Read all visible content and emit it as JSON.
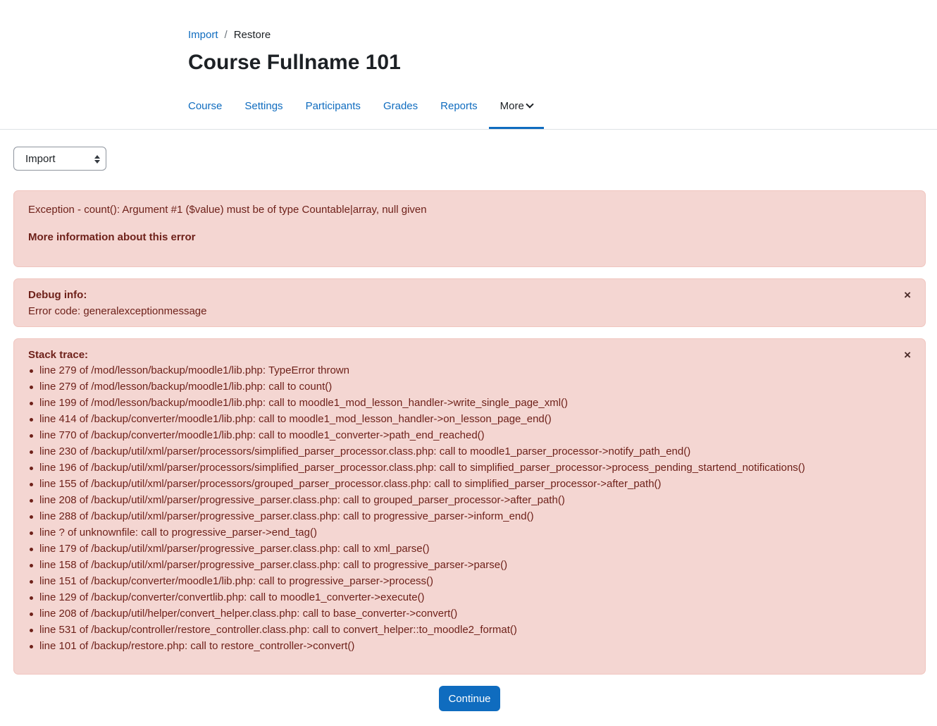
{
  "breadcrumb": {
    "items": [
      {
        "label": "Import",
        "link": true
      },
      {
        "label": "Restore",
        "link": false
      }
    ],
    "separator": "/"
  },
  "page": {
    "title": "Course Fullname 101"
  },
  "secondary_nav": {
    "tabs": [
      {
        "label": "Course",
        "active": false
      },
      {
        "label": "Settings",
        "active": false
      },
      {
        "label": "Participants",
        "active": false
      },
      {
        "label": "Grades",
        "active": false
      },
      {
        "label": "Reports",
        "active": false
      },
      {
        "label": "More",
        "active": true
      }
    ]
  },
  "select": {
    "value": "Import"
  },
  "error": {
    "message": "Exception - count(): Argument #1 ($value) must be of type Countable|array, null given",
    "more_info": "More information about this error"
  },
  "debug": {
    "heading": "Debug info:",
    "error_code": "Error code: generalexceptionmessage",
    "close_symbol": "×"
  },
  "stack": {
    "heading": "Stack trace:",
    "close_symbol": "×",
    "lines": [
      "line 279 of /mod/lesson/backup/moodle1/lib.php: TypeError thrown",
      "line 279 of /mod/lesson/backup/moodle1/lib.php: call to count()",
      "line 199 of /mod/lesson/backup/moodle1/lib.php: call to moodle1_mod_lesson_handler->write_single_page_xml()",
      "line 414 of /backup/converter/moodle1/lib.php: call to moodle1_mod_lesson_handler->on_lesson_page_end()",
      "line 770 of /backup/converter/moodle1/lib.php: call to moodle1_converter->path_end_reached()",
      "line 230 of /backup/util/xml/parser/processors/simplified_parser_processor.class.php: call to moodle1_parser_processor->notify_path_end()",
      "line 196 of /backup/util/xml/parser/processors/simplified_parser_processor.class.php: call to simplified_parser_processor->process_pending_startend_notifications()",
      "line 155 of /backup/util/xml/parser/processors/grouped_parser_processor.class.php: call to simplified_parser_processor->after_path()",
      "line 208 of /backup/util/xml/parser/progressive_parser.class.php: call to grouped_parser_processor->after_path()",
      "line 288 of /backup/util/xml/parser/progressive_parser.class.php: call to progressive_parser->inform_end()",
      "line ? of unknownfile: call to progressive_parser->end_tag()",
      "line 179 of /backup/util/xml/parser/progressive_parser.class.php: call to xml_parse()",
      "line 158 of /backup/util/xml/parser/progressive_parser.class.php: call to progressive_parser->parse()",
      "line 151 of /backup/converter/moodle1/lib.php: call to progressive_parser->process()",
      "line 129 of /backup/converter/convertlib.php: call to moodle1_converter->execute()",
      "line 208 of /backup/util/helper/convert_helper.class.php: call to base_converter->convert()",
      "line 531 of /backup/controller/restore_controller.class.php: call to convert_helper::to_moodle2_format()",
      "line 101 of /backup/restore.php: call to restore_controller->convert()"
    ]
  },
  "actions": {
    "continue_label": "Continue"
  }
}
